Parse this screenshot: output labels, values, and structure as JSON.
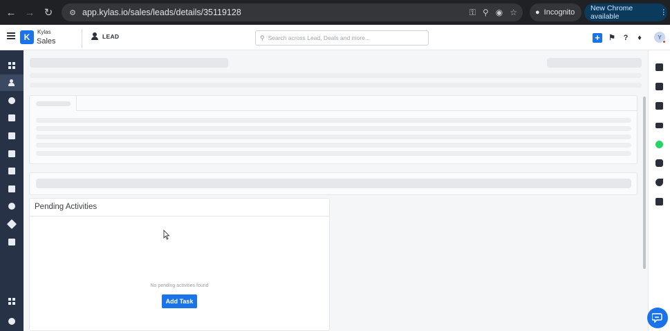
{
  "browser": {
    "url": "app.kylas.io/sales/leads/details/35119128",
    "incognito_label": "Incognito",
    "update_label": "New Chrome available"
  },
  "header": {
    "brand_top": "Kylas",
    "brand_bottom": "Sales",
    "logo_letter": "K",
    "page_title": "LEAD",
    "search_placeholder": "Search across Lead, Deals and more...",
    "avatar_initial": "Y"
  },
  "pending_activities": {
    "title": "Pending Activities",
    "empty_message": "No pending activities found",
    "add_task_label": "Add Task"
  },
  "colors": {
    "accent": "#1a73e8",
    "sidebar": "#283247",
    "whatsapp": "#25d366"
  },
  "left_sidebar_icons": [
    "dashboard-icon",
    "leads-icon",
    "deals-icon",
    "contacts-icon",
    "companies-icon",
    "documents-icon",
    "tasks-icon",
    "calendar-icon",
    "workflow-icon",
    "campaign-icon",
    "reports-icon",
    "apps-grid-icon",
    "settings-icon"
  ],
  "right_rail_icons": [
    "notes-icon",
    "tasks-icon",
    "calendar-icon",
    "email-icon",
    "whatsapp-icon",
    "chat-icon",
    "phone-icon",
    "files-icon"
  ]
}
